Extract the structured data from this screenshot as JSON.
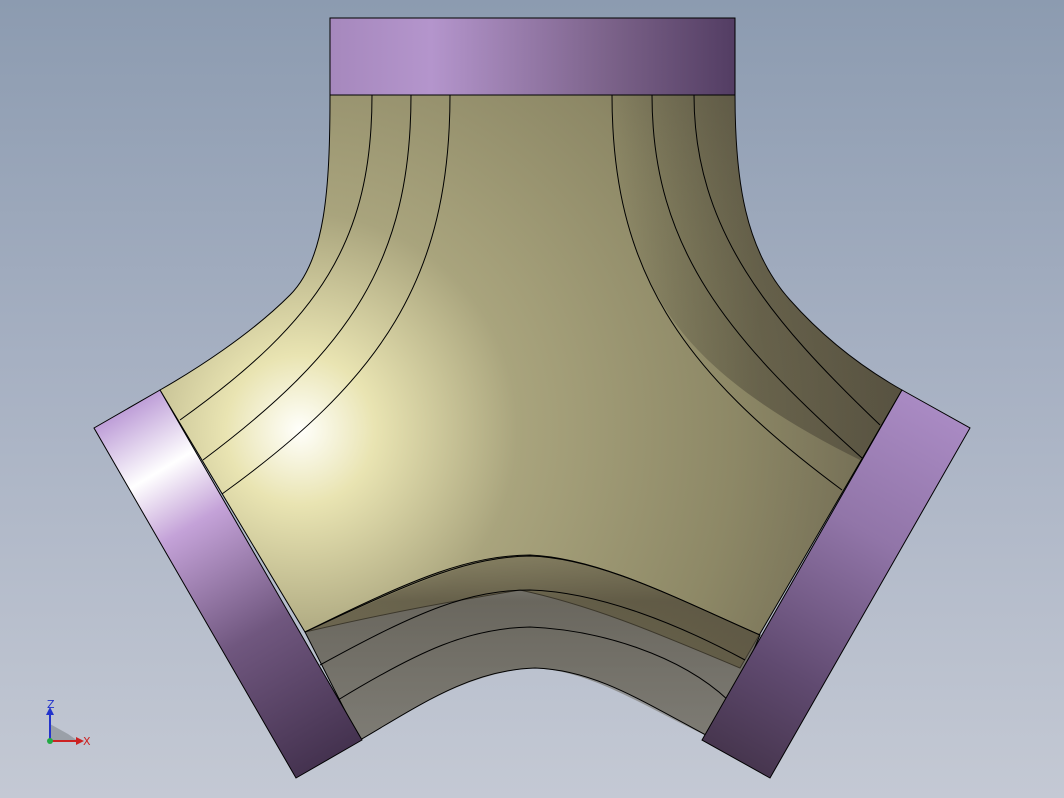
{
  "colors": {
    "background_top": "#8c9bb0",
    "background_bottom": "#c4c9d4",
    "body_surface": "#a7a27a",
    "flange": "#9a7db0",
    "edge_line": "#000000",
    "axis_x": "#cc2222",
    "axis_z": "#2233cc"
  },
  "triad": {
    "z_label": "Z",
    "x_label": "X"
  }
}
